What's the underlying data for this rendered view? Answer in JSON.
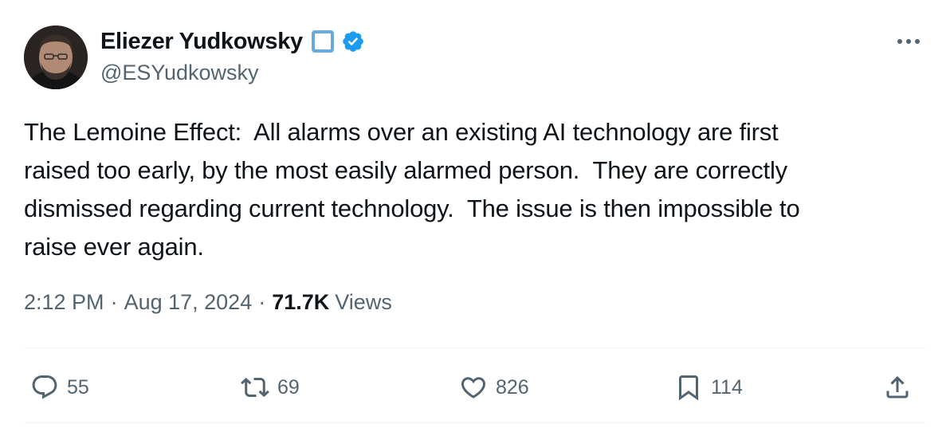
{
  "author": {
    "display_name": "Eliezer Yudkowsky",
    "handle": "@ESYudkowsky",
    "name_emoji": "square-emoji",
    "verified_icon": "verified-badge-icon",
    "verified_color": "#1d9bf0"
  },
  "tweet": {
    "text": "The Lemoine Effect:  All alarms over an existing AI technology are first\nraised too early, by the most easily alarmed person.  They are correctly\ndismissed regarding current technology.  The issue is then impossible to\nraise ever again."
  },
  "meta": {
    "time": "2:12 PM",
    "separator": "·",
    "date": "Aug 17, 2024",
    "views_count": "71.7K",
    "views_label": "Views"
  },
  "actions": {
    "reply_count": "55",
    "retweet_count": "69",
    "like_count": "826",
    "bookmark_count": "114"
  },
  "colors": {
    "text_primary": "#0f1419",
    "text_secondary": "#536471",
    "accent": "#1d9bf0",
    "divider": "#eff3f4"
  }
}
